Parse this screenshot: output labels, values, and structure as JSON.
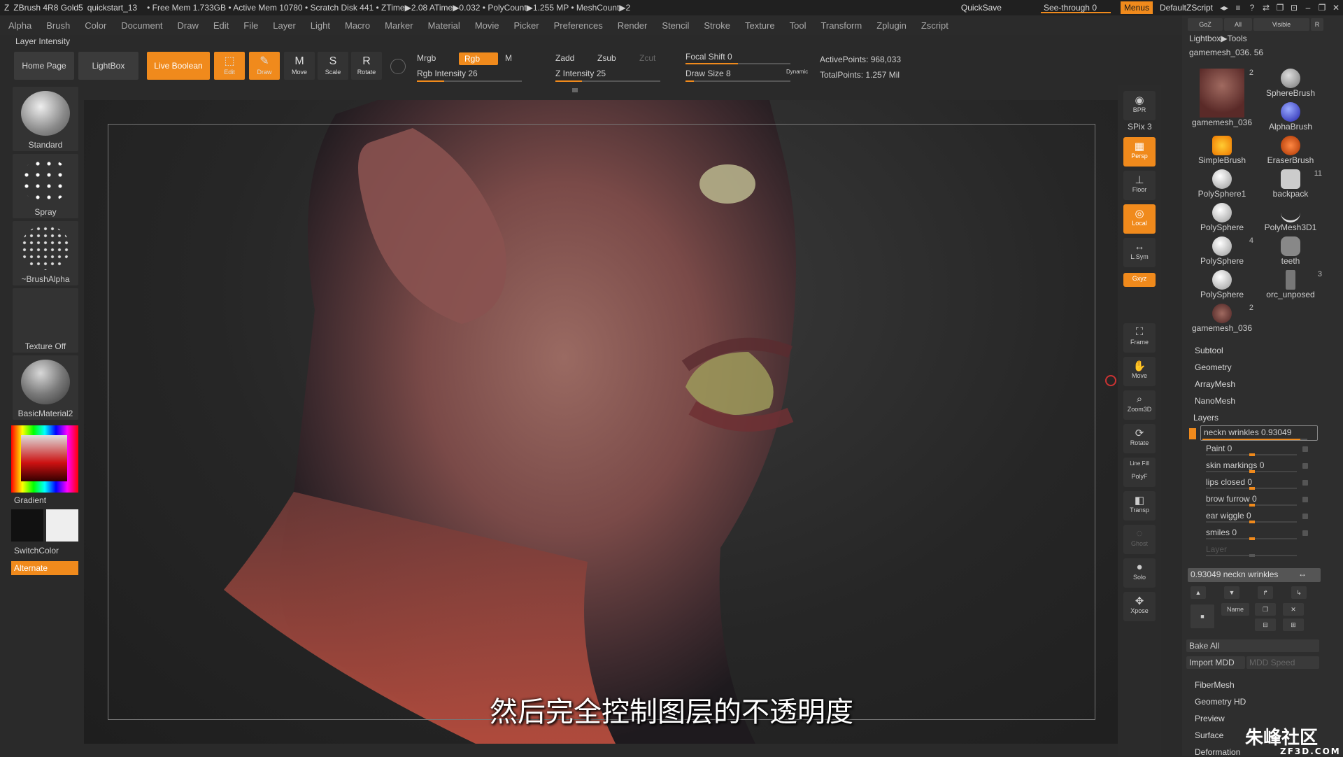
{
  "titlebar": {
    "app": "ZBrush 4R8 Gold5",
    "project": "quickstart_13",
    "status": "• Free Mem 1.733GB • Active Mem 10780 • Scratch Disk 441 •  ZTime▶2.08 ATime▶0.032 • PolyCount▶1.255 MP  • MeshCount▶2",
    "quicksave": "QuickSave",
    "seethrough": "See-through  0",
    "menus": "Menus",
    "script": "DefaultZScript"
  },
  "menu": [
    "Alpha",
    "Brush",
    "Color",
    "Document",
    "Draw",
    "Edit",
    "File",
    "Layer",
    "Light",
    "Macro",
    "Marker",
    "Material",
    "Movie",
    "Picker",
    "Preferences",
    "Render",
    "Stencil",
    "Stroke",
    "Texture",
    "Tool",
    "Transform",
    "Zplugin",
    "Zscript"
  ],
  "palette_label": "Layer Intensity",
  "shelf": {
    "home": "Home Page",
    "lightbox": "LightBox",
    "liveboolean": "Live Boolean",
    "edit": "Edit",
    "draw": "Draw",
    "move": "Move",
    "scale": "Scale",
    "rotate": "Rotate",
    "mrgb": "Mrgb",
    "rgb": "Rgb",
    "m": "M",
    "rgb_intensity": "Rgb Intensity 26",
    "zadd": "Zadd",
    "zsub": "Zsub",
    "zcut": "Zcut",
    "z_intensity": "Z Intensity 25",
    "focal_shift": "Focal Shift 0",
    "draw_size": "Draw Size 8",
    "dynamic": "Dynamic",
    "active_points": "ActivePoints: 968,033",
    "total_points": "TotalPoints: 1.257 Mil"
  },
  "lefttray": {
    "standard": "Standard",
    "spray": "Spray",
    "brushalpha": "~BrushAlpha",
    "texture": "Texture Off",
    "material": "BasicMaterial2",
    "gradient": "Gradient",
    "switchcolor": "SwitchColor",
    "alternate": "Alternate"
  },
  "rtools": {
    "bpr": "BPR",
    "spix": "SPix 3",
    "persp": "Persp",
    "floor": "Floor",
    "local": "Local",
    "lsym": "L.Sym",
    "xyz": "Gxyz",
    "frame": "Frame",
    "move": "Move",
    "zoom3d": "Zoom3D",
    "rotate": "Rotate",
    "linefill": "Line Fill",
    "polyf": "PolyF",
    "transp": "Transp",
    "ghost": "Ghost",
    "solo": "Solo",
    "xpose": "Xpose"
  },
  "righttray": {
    "goz": "GoZ",
    "all": "All",
    "visible": "Visible",
    "r": "R",
    "lightbox_tools": "Lightbox▶Tools",
    "current_tool": "gamemesh_036. 56",
    "subtools": [
      {
        "name": "gamemesh_036",
        "count": "2"
      },
      {
        "name": "SphereBrush",
        "count": ""
      },
      {
        "name": "AlphaBrush",
        "count": ""
      },
      {
        "name": "SimpleBrush",
        "count": ""
      },
      {
        "name": "EraserBrush",
        "count": ""
      },
      {
        "name": "PolySphere1",
        "count": ""
      },
      {
        "name": "backpack",
        "count": "11"
      },
      {
        "name": "PolySphere",
        "count": ""
      },
      {
        "name": "PolyMesh3D1",
        "count": ""
      },
      {
        "name": "PolySphere",
        "count": "4"
      },
      {
        "name": "teeth",
        "count": ""
      },
      {
        "name": "PolySphere",
        "count": ""
      },
      {
        "name": "orc_unposed",
        "count": "3"
      },
      {
        "name": "gamemesh_036",
        "count": "2"
      }
    ],
    "sections": [
      "Subtool",
      "Geometry",
      "ArrayMesh",
      "NanoMesh",
      "Layers"
    ],
    "layers": [
      {
        "name": "neckn wrinkles 0.93049"
      },
      {
        "name": "Paint 0"
      },
      {
        "name": "skin markings 0"
      },
      {
        "name": "lips closed 0"
      },
      {
        "name": "brow furrow 0"
      },
      {
        "name": "ear wiggle 0"
      },
      {
        "name": "smiles 0"
      },
      {
        "name": "Layer"
      }
    ],
    "intensity_slider": "0.93049 neckn wrinkles",
    "name_btn": "Name",
    "bake_all": "Bake All",
    "import_mdd": "Import MDD",
    "mdd_speed": "MDD Speed",
    "lower_sections": [
      "FiberMesh",
      "Geometry HD",
      "Preview",
      "Surface",
      "Deformation"
    ]
  },
  "subtitle": "然后完全控制图层的不透明度",
  "watermark": {
    "top": "朱峰社区",
    "bottom": "ZF3D.COM"
  },
  "colors": {
    "accent": "#f08a1c",
    "background": "#2a2a2a"
  }
}
